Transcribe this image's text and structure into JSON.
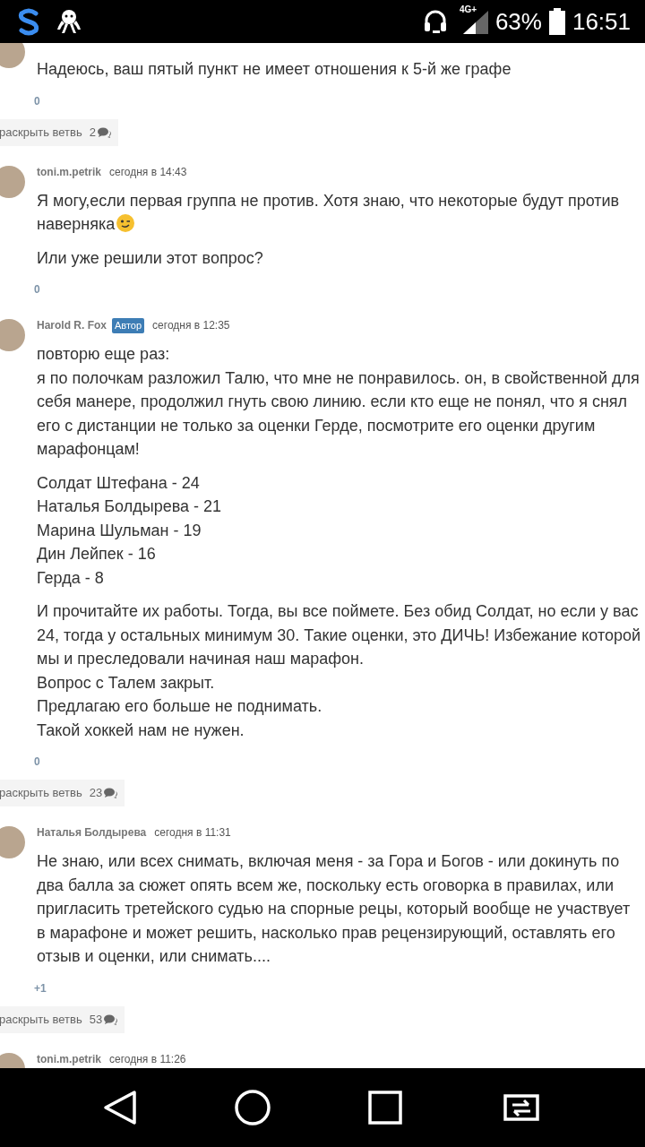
{
  "status_bar": {
    "network": "4G+",
    "battery": "63%",
    "time": "16:51"
  },
  "comments": [
    {
      "paragraphs": [
        "Надеюсь, ваш пятый пункт не имеет отношения к 5-й же графе"
      ],
      "score": "0",
      "thread_label": "раскрыть ветвь",
      "thread_count": "2"
    },
    {
      "author": "toni.m.petrik",
      "time": "сегодня в 14:43",
      "paragraphs": [
        {
          "text": "Я могу,если первая группа не против. Хотя знаю, что некоторые будут против наверняка",
          "wink_emoji": true
        },
        "Или уже решили этот вопрос?"
      ],
      "score": "0"
    },
    {
      "author": "Harold R. Fox",
      "badge": "Автор",
      "time": "сегодня в 12:35",
      "paragraphs": [
        "повторю еще раз:\nя по полочкам разложил Талю, что мне не понравилось. он, в свойственной для себя манере, продолжил гнуть свою линию. если кто еще не понял, что я снял его с дистанции не только за оценки Герде, посмотрите его оценки другим марафонцам!",
        "Солдат Штефана - 24\nНаталья Болдырева - 21\nМарина Шульман - 19\nДин Лейпек - 16\nГерда - 8",
        "И прочитайте их работы. Тогда, вы все поймете. Без обид Солдат, но если у вас 24, тогда у остальных минимум 30. Такие оценки, это ДИЧЬ! Избежание которой мы и преследовали начиная наш марафон.\nВопрос с Талем закрыт.\nПредлагаю его больше не поднимать.\nТакой хоккей нам не нужен."
      ],
      "score": "0",
      "thread_label": "раскрыть ветвь",
      "thread_count": "23"
    },
    {
      "author": "Наталья Болдырева",
      "time": "сегодня в 11:31",
      "paragraphs": [
        "Не знаю, или всех снимать, включая меня - за Гора и Богов - или докинуть по два балла за сюжет опять всем же, поскольку есть оговорка в правилах, или пригласить третейского судью на спорные рецы, который вообще не участвует в марафоне и может решить, насколько прав рецензирующий, оставлять его отзыв и оценки, или снимать...."
      ],
      "score": "+1",
      "thread_label": "раскрыть ветвь",
      "thread_count": "53"
    },
    {
      "author": "toni.m.petrik",
      "time": "сегодня в 11:26"
    }
  ]
}
